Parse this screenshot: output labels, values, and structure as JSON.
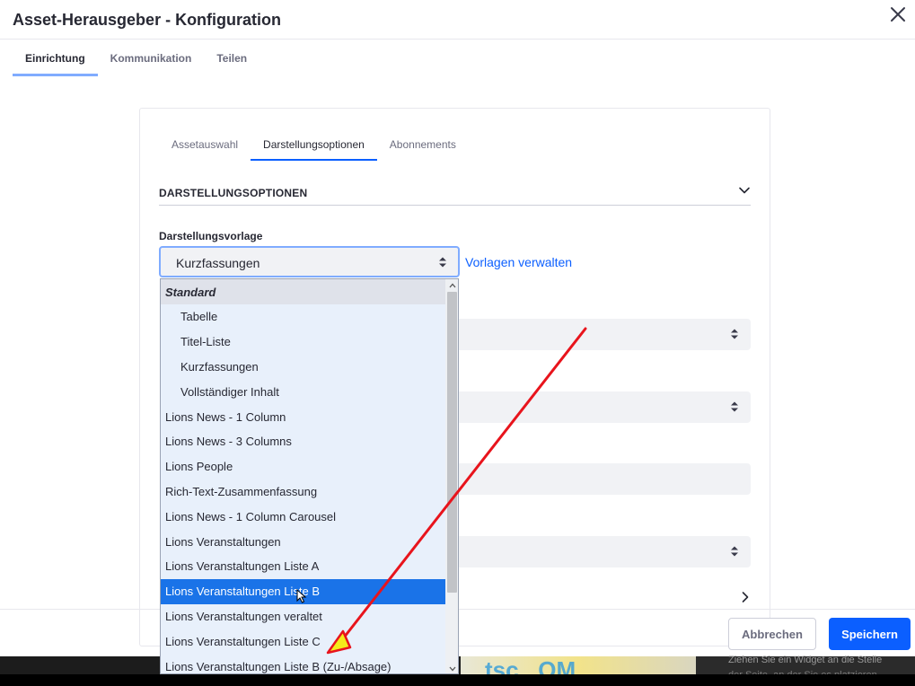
{
  "dialog": {
    "title": "Asset-Herausgeber - Konfiguration"
  },
  "top_tabs": [
    {
      "label": "Einrichtung",
      "active": true
    },
    {
      "label": "Kommunikation",
      "active": false
    },
    {
      "label": "Teilen",
      "active": false
    }
  ],
  "sub_tabs": [
    {
      "label": "Assetauswahl",
      "active": false
    },
    {
      "label": "Darstellungsoptionen",
      "active": true
    },
    {
      "label": "Abonnements",
      "active": false
    }
  ],
  "section": {
    "title": "DARSTELLUNGSOPTIONEN"
  },
  "template_field": {
    "label": "Darstellungsvorlage",
    "value": "Kurzfassungen",
    "manage_link": "Vorlagen verwalten"
  },
  "dropdown": {
    "items": [
      {
        "label": "Standard",
        "kind": "group"
      },
      {
        "label": "Tabelle",
        "kind": "indent"
      },
      {
        "label": "Titel-Liste",
        "kind": "indent"
      },
      {
        "label": "Kurzfassungen",
        "kind": "indent"
      },
      {
        "label": "Vollständiger Inhalt",
        "kind": "indent"
      },
      {
        "label": "Lions News - 1 Column",
        "kind": "option"
      },
      {
        "label": "Lions News - 3 Columns",
        "kind": "option"
      },
      {
        "label": "Lions People",
        "kind": "option"
      },
      {
        "label": "Rich-Text-Zusammenfassung",
        "kind": "option"
      },
      {
        "label": "Lions News - 1 Column Carousel",
        "kind": "option"
      },
      {
        "label": "Lions Veranstaltungen",
        "kind": "option"
      },
      {
        "label": "Lions Veranstaltungen Liste A",
        "kind": "option"
      },
      {
        "label": "Lions Veranstaltungen Liste B",
        "kind": "selected"
      },
      {
        "label": "Lions Veranstaltungen veraltet",
        "kind": "option"
      },
      {
        "label": "Lions Veranstaltungen Liste C",
        "kind": "option"
      },
      {
        "label": "Lions Veranstaltungen Liste B (Zu-/Absage)",
        "kind": "option"
      }
    ]
  },
  "footer": {
    "cancel_label": "Abbrechen",
    "save_label": "Speichern"
  },
  "background": {
    "hint_line1": "Ziehen Sie ein Widget an die Stelle",
    "hint_line2": "der Seite, an der Sie es platzieren"
  },
  "colors": {
    "accent": "#0b5fff",
    "selected_item": "#1a73e8",
    "annotation_arrow": "#e8141c",
    "annotation_arrowhead": "#f5ec1a"
  }
}
